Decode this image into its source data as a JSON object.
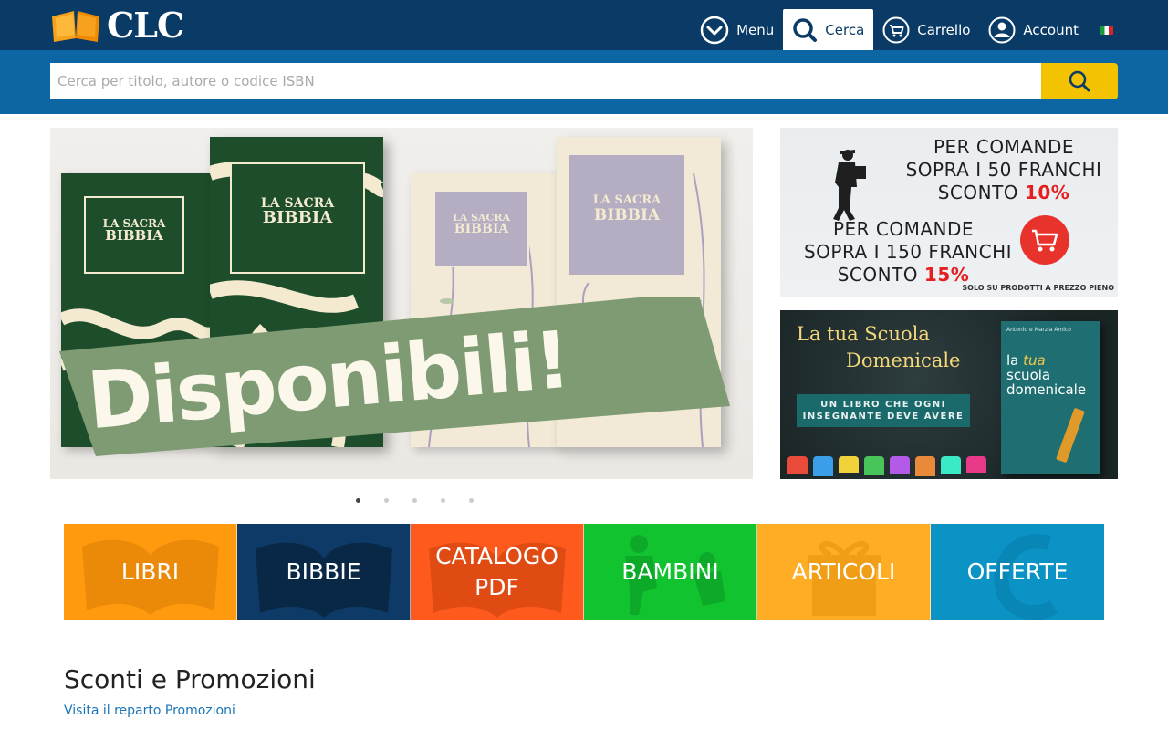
{
  "header": {
    "logo_text": "CLC",
    "nav": {
      "menu": "Menu",
      "search": "Cerca",
      "cart": "Carrello",
      "account": "Account"
    },
    "language_flag": "flag-italy-icon"
  },
  "search": {
    "placeholder": "Cerca per titolo, autore o codice ISBN",
    "value": ""
  },
  "hero": {
    "headline": "Disponibili!",
    "book_title_line1": "LA SACRA",
    "book_title_line2": "BIBBIA",
    "slides_total": 5,
    "slide_active": 1
  },
  "promo_discount": {
    "line1": "PER COMANDE",
    "line2": "SOPRA I 50 FRANCHI",
    "line3_prefix": "SCONTO ",
    "line3_value": "10%",
    "line4": "PER COMANDE",
    "line5": "SOPRA I 150 FRANCHI",
    "line6_prefix": "SCONTO ",
    "line6_value": "15%",
    "note": "SOLO SU PRODOTTI A PREZZO PIENO"
  },
  "promo_school": {
    "title_line1": "La tua Scuola",
    "title_line2": "Domenicale",
    "tagline_line1": "UN LIBRO CHE OGNI",
    "tagline_line2": "INSEGNANTE DEVE AVERE",
    "book_authors": "Antonio e Marzia Amico",
    "book_title_line1": "la",
    "book_title_tua": "tua",
    "book_title_line2": "scuola",
    "book_title_line3": "domenicale"
  },
  "categories": [
    {
      "label": "LIBRI",
      "color": "#ff9a0e"
    },
    {
      "label": "BIBBIE",
      "color": "#0d3a66"
    },
    {
      "label_line1": "CATALOGO",
      "label_line2": "PDF",
      "color": "#ff5a1e"
    },
    {
      "label": "BAMBINI",
      "color": "#11c42f"
    },
    {
      "label": "ARTICOLI",
      "color": "#ffad24"
    },
    {
      "label": "OFFERTE",
      "color": "#0a93c4"
    }
  ],
  "section": {
    "title": "Sconti e Promozioni",
    "link": "Visita il reparto Promozioni"
  },
  "colors": {
    "header_bg": "#0a3a66",
    "search_band_bg": "#0b66a3",
    "search_button": "#f3c200",
    "link": "#1a75b8"
  }
}
